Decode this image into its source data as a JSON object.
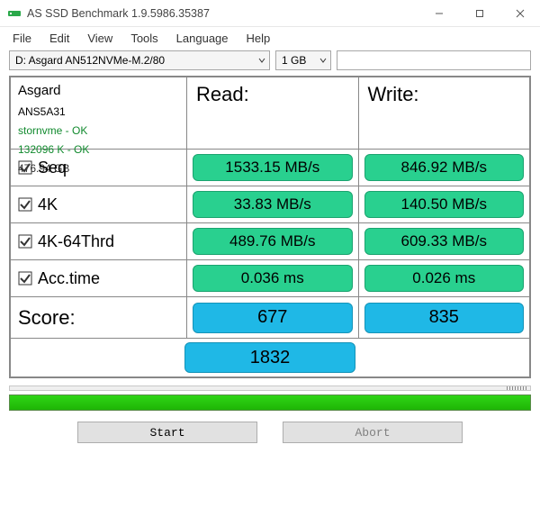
{
  "window": {
    "title": "AS SSD Benchmark 1.9.5986.35387"
  },
  "menu": {
    "file": "File",
    "edit": "Edit",
    "view": "View",
    "tools": "Tools",
    "language": "Language",
    "help": "Help"
  },
  "controls": {
    "drive_selected": "D: Asgard AN512NVMe-M.2/80",
    "size_selected": "1 GB"
  },
  "info": {
    "vendor": "Asgard",
    "model": "ANS5A31",
    "driver_status": "stornvme - OK",
    "alignment_status": "132096 K - OK",
    "capacity": "476.94 GB"
  },
  "headers": {
    "read": "Read:",
    "write": "Write:"
  },
  "tests": {
    "seq": {
      "label": "Seq",
      "read": "1533.15 MB/s",
      "write": "846.92 MB/s"
    },
    "k4": {
      "label": "4K",
      "read": "33.83 MB/s",
      "write": "140.50 MB/s"
    },
    "k4_64": {
      "label": "4K-64Thrd",
      "read": "489.76 MB/s",
      "write": "609.33 MB/s"
    },
    "acc": {
      "label": "Acc.time",
      "read": "0.036 ms",
      "write": "0.026 ms"
    }
  },
  "score": {
    "label": "Score:",
    "read": "677",
    "write": "835",
    "total": "1832"
  },
  "buttons": {
    "start": "Start",
    "abort": "Abort"
  }
}
